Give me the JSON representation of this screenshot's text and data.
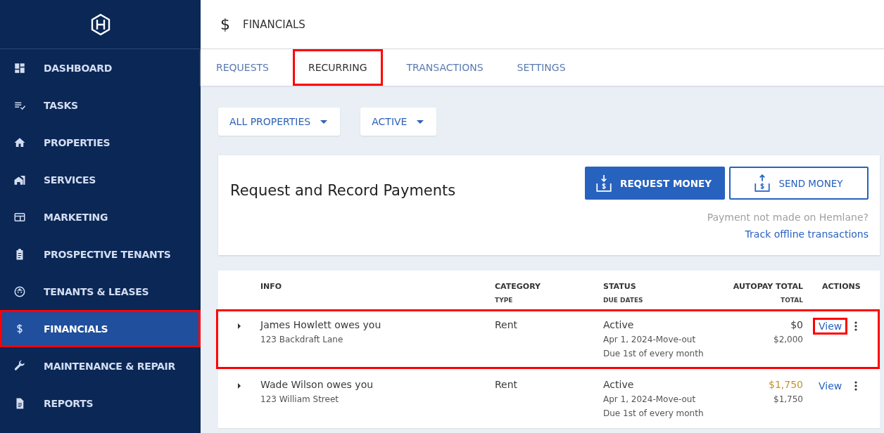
{
  "sidebar": {
    "items": [
      {
        "label": "DASHBOARD",
        "selected": false,
        "highlighted": false
      },
      {
        "label": "TASKS",
        "selected": false,
        "highlighted": false
      },
      {
        "label": "PROPERTIES",
        "selected": false,
        "highlighted": false
      },
      {
        "label": "SERVICES",
        "selected": false,
        "highlighted": false
      },
      {
        "label": "MARKETING",
        "selected": false,
        "highlighted": false
      },
      {
        "label": "PROSPECTIVE TENANTS",
        "selected": false,
        "highlighted": false
      },
      {
        "label": "TENANTS & LEASES",
        "selected": false,
        "highlighted": false
      },
      {
        "label": "FINANCIALS",
        "selected": true,
        "highlighted": true
      },
      {
        "label": "MAINTENANCE & REPAIR",
        "selected": false,
        "highlighted": false
      },
      {
        "label": "REPORTS",
        "selected": false,
        "highlighted": false
      }
    ]
  },
  "header": {
    "icon_text": "$",
    "title": "FINANCIALS"
  },
  "tabs": [
    {
      "label": "REQUESTS",
      "selected": false,
      "highlighted": false
    },
    {
      "label": "RECURRING",
      "selected": true,
      "highlighted": true
    },
    {
      "label": "TRANSACTIONS",
      "selected": false,
      "highlighted": false
    },
    {
      "label": "SETTINGS",
      "selected": false,
      "highlighted": false
    }
  ],
  "filters": [
    {
      "label": "ALL PROPERTIES"
    },
    {
      "label": "ACTIVE"
    }
  ],
  "payments_card": {
    "title": "Request and Record Payments",
    "buttons": [
      {
        "label": "REQUEST MONEY",
        "kind": "primary"
      },
      {
        "label": "SEND MONEY",
        "kind": "secondary"
      }
    ],
    "note": "Payment not made on Hemlane?",
    "link": "Track offline transactions"
  },
  "table": {
    "columns": [
      {
        "label": "INFO"
      },
      {
        "label": "CATEGORY",
        "sub": "TYPE"
      },
      {
        "label": "STATUS",
        "sub": "DUE DATES"
      },
      {
        "label": "AUTOPAY TOTAL",
        "sub": "TOTAL"
      },
      {
        "label": "ACTIONS"
      }
    ],
    "rows": [
      {
        "title": "James Howlett owes you",
        "address": "123 Backdraft Lane",
        "category": "Rent",
        "status": "Active",
        "dates": "Apr 1, 2024-Move-out",
        "due": "Due 1st of every month",
        "autopay": "$0",
        "color": "#3a3a3a",
        "total": "$2,000",
        "action": "View",
        "highlighted": true,
        "action_highlighted": true
      },
      {
        "title": "Wade Wilson owes you",
        "address": "123 William Street",
        "category": "Rent",
        "status": "Active",
        "dates": "Apr 1, 2024-Move-out",
        "due": "Due 1st of every month",
        "autopay": "$1,750",
        "color": "#c8912c",
        "total": "$1,750",
        "action": "View",
        "highlighted": false,
        "action_highlighted": false
      }
    ]
  }
}
